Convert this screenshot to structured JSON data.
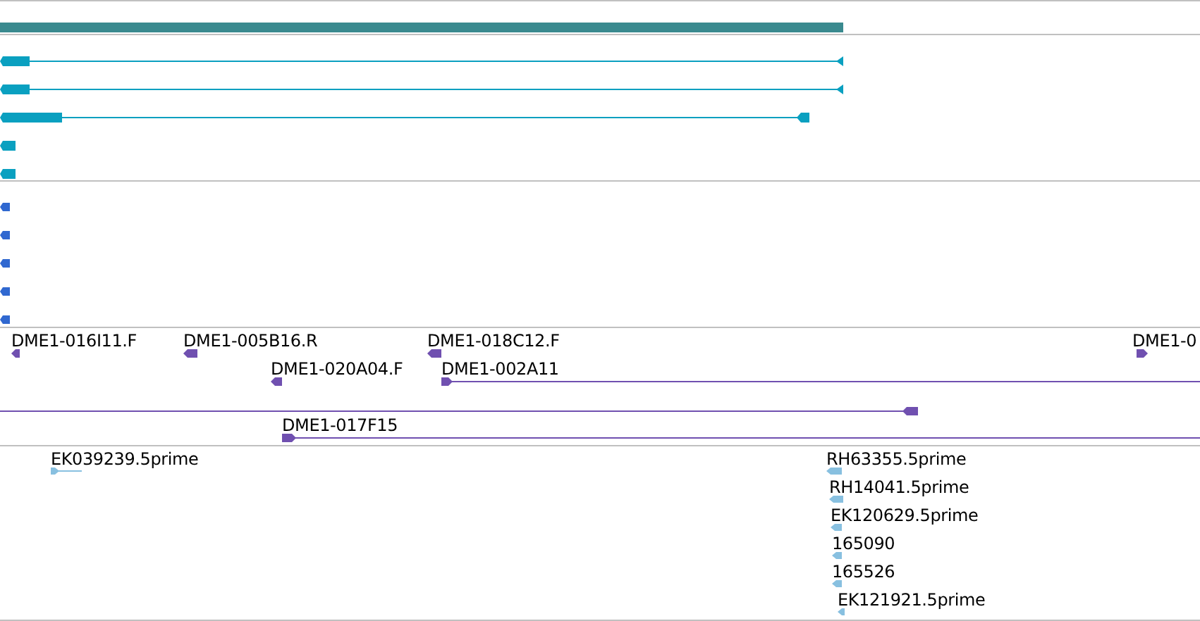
{
  "tracks": [
    {
      "kind": "bar"
    },
    {
      "kind": "transcripts"
    },
    {
      "kind": "blocks"
    },
    {
      "kind": "clones",
      "features": [
        {
          "label": "DME1-016I11.F",
          "reverse": true
        },
        {
          "label": "DME1-005B16.R",
          "reverse": true
        },
        {
          "label": "DME1-018C12.F",
          "reverse": true
        },
        {
          "label": "DME1-0",
          "reverse": false
        },
        {
          "label": "DME1-020A04.F",
          "reverse": true
        },
        {
          "label": "DME1-002A11",
          "reverse": false
        },
        {
          "label": "DME1-017F15",
          "reverse": false
        }
      ]
    },
    {
      "kind": "ests",
      "features": [
        {
          "label": "EK039239.5prime",
          "reverse": false
        },
        {
          "label": "RH63355.5prime",
          "reverse": true
        },
        {
          "label": "RH14041.5prime",
          "reverse": true
        },
        {
          "label": "EK120629.5prime",
          "reverse": true
        },
        {
          "label": "165090",
          "reverse": true
        },
        {
          "label": "165526",
          "reverse": true
        },
        {
          "label": "EK121921.5prime",
          "reverse": true
        }
      ]
    }
  ]
}
